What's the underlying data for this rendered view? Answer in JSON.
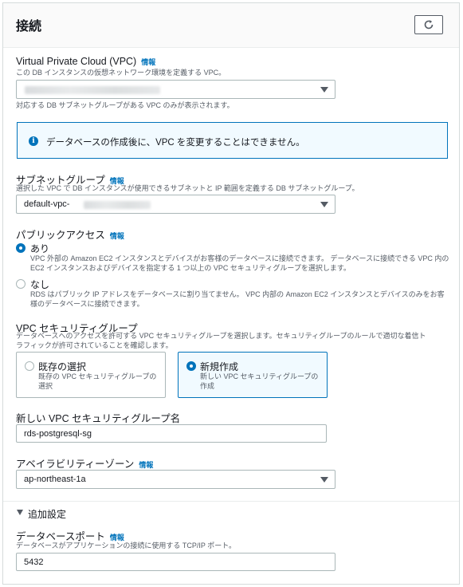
{
  "header": {
    "title": "接続",
    "refresh_icon": "refresh-icon"
  },
  "vpc": {
    "label": "Virtual Private Cloud (VPC)",
    "info": "情報",
    "description": "この DB インスタンスの仮想ネットワーク環境を定義する VPC。",
    "help": "対応する DB サブネットグループがある VPC のみが表示されます。"
  },
  "alert": {
    "text": "データベースの作成後に、VPC を変更することはできません。"
  },
  "subnet": {
    "label": "サブネットグループ",
    "info": "情報",
    "description": "選択した VPC で DB インスタンスが使用できるサブネットと IP 範囲を定義する DB サブネットグループ。",
    "value_prefix": "default-vpc-"
  },
  "public_access": {
    "label": "パブリックアクセス",
    "info": "情報",
    "options": [
      {
        "title": "あり",
        "selected": true,
        "desc_line1": "VPC 外部の Amazon EC2 インスタンスとデバイスがお客様のデータベースに接続できます。 データベースに接続できる VPC 内の",
        "desc_line2": "EC2 インスタンスおよびデバイスを指定する 1 つ以上の VPC セキュリティグループを選択します。"
      },
      {
        "title": "なし",
        "selected": false,
        "desc_line1": "RDS はパブリック IP アドレスをデータベースに割り当てません。 VPC 内部の Amazon EC2 インスタンスとデバイスのみをお客",
        "desc_line2": "様のデータベースに接続できます。"
      }
    ]
  },
  "security_group": {
    "label": "VPC セキュリティグループ",
    "desc_line1": "データベースへのアクセスを許可する VPC セキュリティグループを選択します。セキュリティグループのルールで適切な着信ト",
    "desc_line2": "ラフィックが許可されていることを確認します。",
    "tiles": [
      {
        "title": "既存の選択",
        "desc_line1": "既存の VPC セキュリティグループの",
        "desc_line2": "選択",
        "selected": false
      },
      {
        "title": "新規作成",
        "desc_line1": "新しい VPC セキュリティグループの",
        "desc_line2": "作成",
        "selected": true
      }
    ]
  },
  "new_sg": {
    "label": "新しい VPC セキュリティグループ名",
    "value": "rds-postgresql-sg"
  },
  "az": {
    "label": "アベイラビリティーゾーン",
    "info": "情報",
    "value": "ap-northeast-1a"
  },
  "additional": {
    "label": "追加設定"
  },
  "port": {
    "label": "データベースポート",
    "info": "情報",
    "description": "データベースがアプリケーションの接続に使用する TCP/IP ポート。",
    "value": "5432"
  }
}
